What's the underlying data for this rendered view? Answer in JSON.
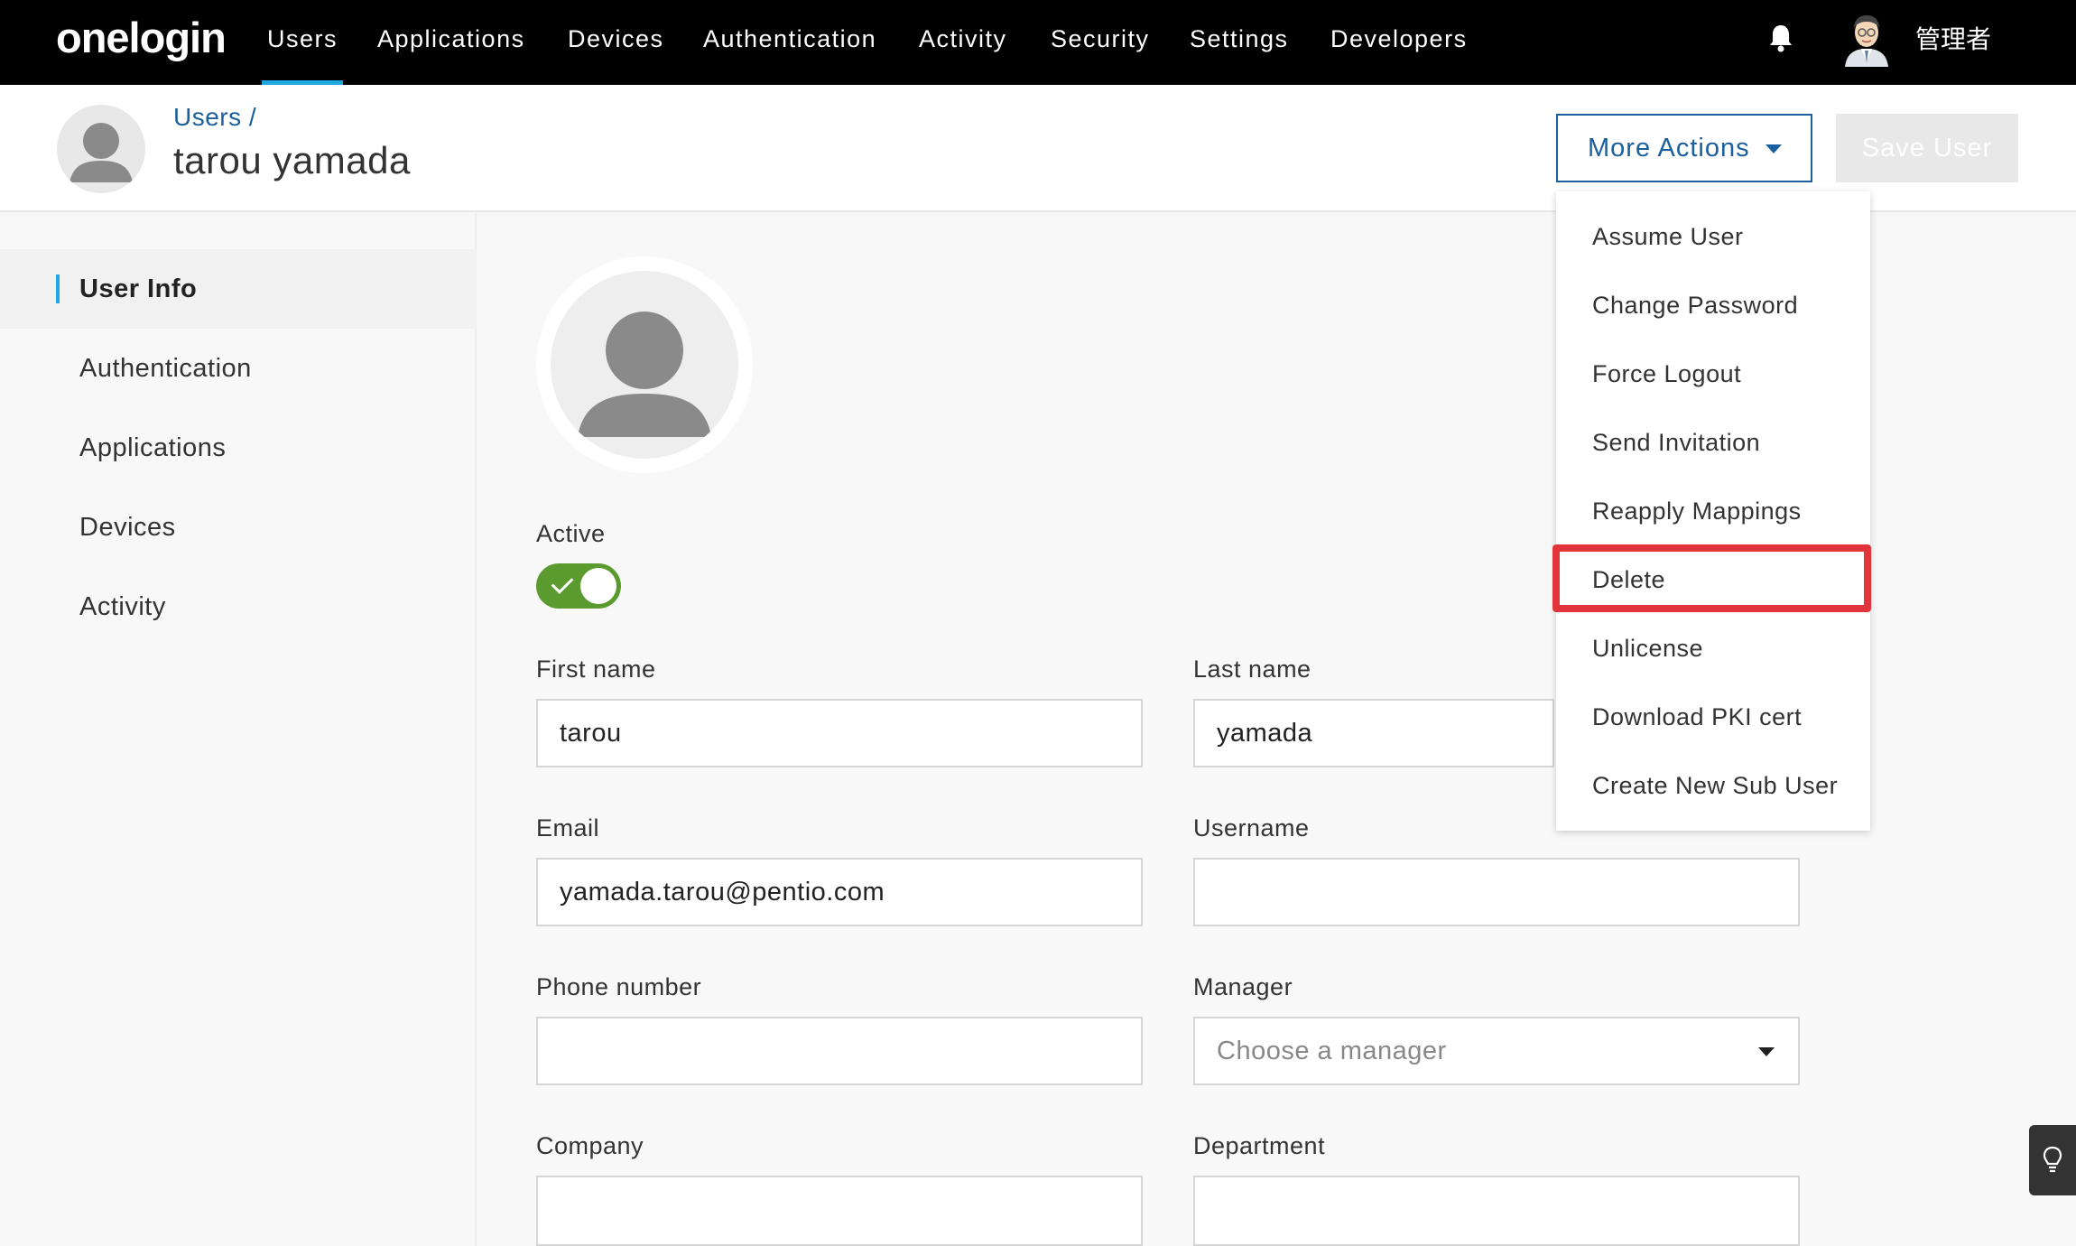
{
  "app": {
    "logo": "onelogin"
  },
  "nav": {
    "items": [
      "Users",
      "Applications",
      "Devices",
      "Authentication",
      "Activity",
      "Security",
      "Settings",
      "Developers"
    ],
    "active": "Users",
    "admin_name": "管理者"
  },
  "header": {
    "breadcrumb": "Users /",
    "title": "tarou yamada",
    "more_actions_label": "More Actions",
    "save_label": "Save User"
  },
  "sidebar": {
    "items": [
      "User Info",
      "Authentication",
      "Applications",
      "Devices",
      "Activity"
    ],
    "active": "User Info"
  },
  "form": {
    "active_label": "Active",
    "active_on": true,
    "first_name_label": "First name",
    "first_name": "tarou",
    "last_name_label": "Last name",
    "last_name": "yamada",
    "email_label": "Email",
    "email": "yamada.tarou@pentio.com",
    "username_label": "Username",
    "username": "",
    "phone_label": "Phone number",
    "phone": "",
    "manager_label": "Manager",
    "manager_placeholder": "Choose a manager",
    "company_label": "Company",
    "company": "",
    "department_label": "Department",
    "department": ""
  },
  "dropdown": {
    "items": [
      "Assume User",
      "Change Password",
      "Force Logout",
      "Send Invitation",
      "Reapply Mappings",
      "Delete",
      "Unlicense",
      "Download PKI cert",
      "Create New Sub User"
    ],
    "highlighted": "Delete"
  },
  "colors": {
    "nav_bg": "#000000",
    "accent": "#1fa8e0",
    "primary": "#1a5f9e",
    "toggle_on": "#5a9a2e",
    "highlight": "#e2343b"
  }
}
